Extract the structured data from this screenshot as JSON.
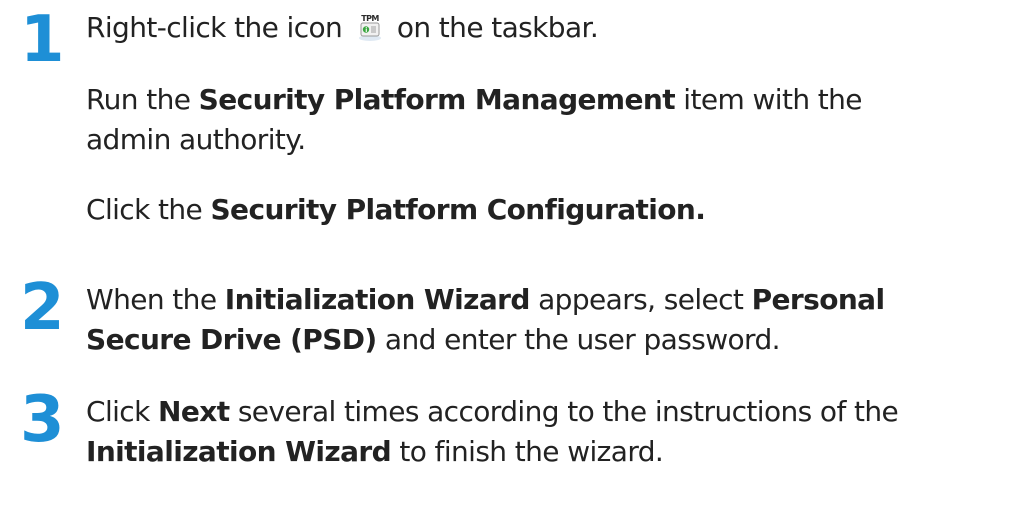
{
  "steps": [
    {
      "number": "1",
      "lines": {
        "a_before": "Right-click the icon",
        "a_after": "on the taskbar.",
        "b_before": "Run the ",
        "b_bold": "Security Platform Management",
        "b_after": " item with the",
        "b_line2": "admin authority.",
        "c_before": "Click the ",
        "c_bold": "Security Platform Configuration."
      },
      "icon": {
        "name": "tpm-icon",
        "label_top": "TPM",
        "label_bottom": "i"
      }
    },
    {
      "number": "2",
      "lines": {
        "a_before": "When the ",
        "a_bold1": "Initialization Wizard",
        "a_mid": " appears, select ",
        "a_bold2": "Personal",
        "b_bold": "Secure Drive (PSD)",
        "b_after": " and enter the user password."
      }
    },
    {
      "number": "3",
      "lines": {
        "a_before": "Click ",
        "a_bold": "Next",
        "a_after": " several times according to the instructions of the",
        "b_bold": "Initialization Wizard",
        "b_after": " to finish the wizard."
      }
    }
  ],
  "colors": {
    "step_number": "#1e8fd6",
    "text": "#222222"
  }
}
